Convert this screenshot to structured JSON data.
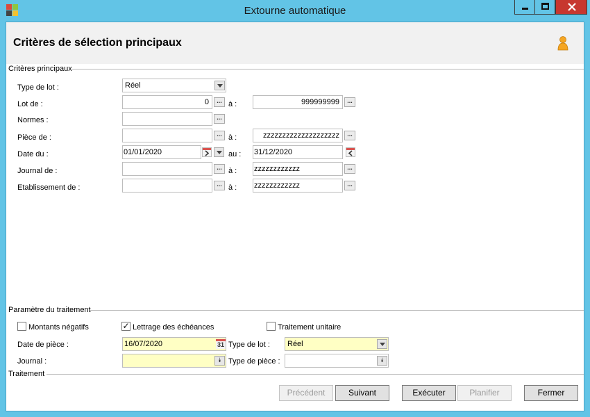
{
  "window": {
    "title": "Extourne automatique"
  },
  "header": {
    "title": "Critères de sélection principaux"
  },
  "groups": {
    "principal": "Critères principaux",
    "parametres": "Paramètre du traitement",
    "traitement": "Traitement"
  },
  "criteria": {
    "type_lot": {
      "label": "Type de lot :",
      "value": "Réel"
    },
    "lot": {
      "label": "Lot de :",
      "from": "0",
      "to_label": "à :",
      "to": "999999999"
    },
    "normes": {
      "label": "Normes :",
      "value": ""
    },
    "piece": {
      "label": "Pièce de :",
      "from": "",
      "to_label": "à :",
      "to": "zzzzzzzzzzzzzzzzzzzz"
    },
    "date": {
      "label": "Date du :",
      "from": "01/01/2020",
      "to_label": "au :",
      "to": "31/12/2020"
    },
    "journal": {
      "label": "Journal de :",
      "from": "",
      "to_label": "à :",
      "to": "zzzzzzzzzzzz"
    },
    "etablissement": {
      "label": "Etablissement de :",
      "from": "",
      "to_label": "à :",
      "to": "zzzzzzzzzzzz"
    }
  },
  "params": {
    "montants_negatifs": {
      "label": "Montants négatifs",
      "checked": false
    },
    "lettrage": {
      "label": "Lettrage des échéances",
      "checked": true
    },
    "traitement_unitaire": {
      "label": "Traitement unitaire",
      "checked": false
    },
    "date_piece": {
      "label": "Date de pièce :",
      "value": "16/07/2020"
    },
    "type_lot": {
      "label": "Type de lot :",
      "value": "Réel"
    },
    "journal": {
      "label": "Journal :",
      "value": ""
    },
    "type_piece": {
      "label": "Type de pièce :",
      "value": ""
    },
    "calendar_day": "31"
  },
  "buttons": {
    "precedent": "Précédent",
    "suivant": "Suivant",
    "executer": "Exécuter",
    "planifier": "Planifier",
    "fermer": "Fermer"
  },
  "colors": {
    "titlebar": "#62c4e6",
    "highlight_field": "#ffffc4",
    "close": "#c7372f"
  }
}
